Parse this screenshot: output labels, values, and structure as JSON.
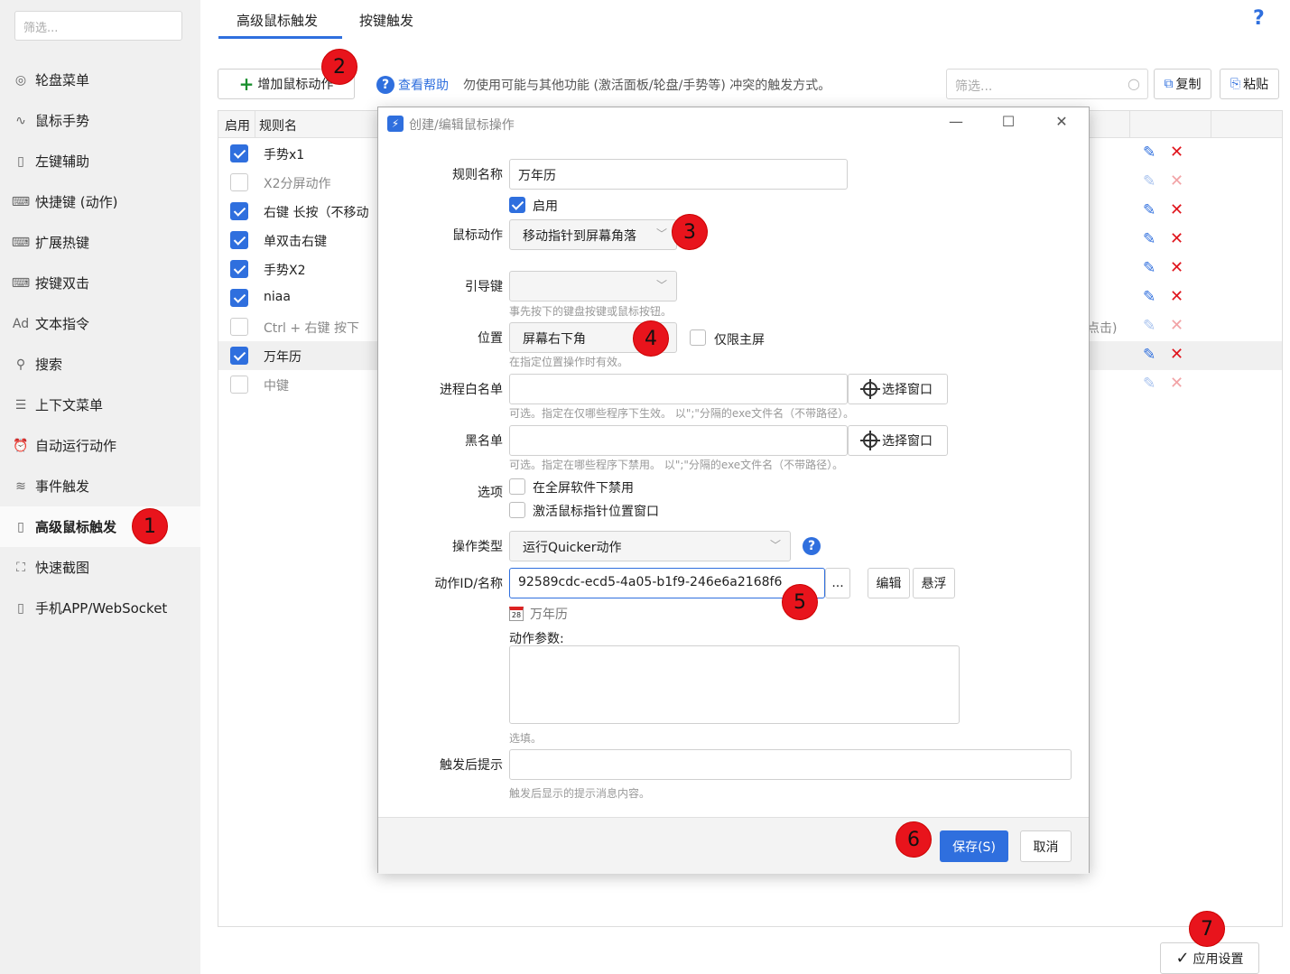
{
  "sidebar": {
    "filter_placeholder": "筛选...",
    "items": [
      {
        "label": "轮盘菜单",
        "icon": "◎"
      },
      {
        "label": "鼠标手势",
        "icon": "∿"
      },
      {
        "label": "左键辅助",
        "icon": "▯"
      },
      {
        "label": "快捷键 (动作)",
        "icon": "⌨"
      },
      {
        "label": "扩展热键",
        "icon": "⌨"
      },
      {
        "label": "按键双击",
        "icon": "⌨"
      },
      {
        "label": "文本指令",
        "icon": "Ad"
      },
      {
        "label": "搜索",
        "icon": "⚲"
      },
      {
        "label": "上下文菜单",
        "icon": "☰"
      },
      {
        "label": "自动运行动作",
        "icon": "⏰"
      },
      {
        "label": "事件触发",
        "icon": "≋"
      },
      {
        "label": "高级鼠标触发",
        "icon": "▯"
      },
      {
        "label": "快速截图",
        "icon": "⛶"
      },
      {
        "label": "手机APP/WebSocket",
        "icon": "▯"
      }
    ]
  },
  "tabs": [
    "高级鼠标触发",
    "按键触发"
  ],
  "help_icon": "?",
  "toolbar": {
    "add_label": "增加鼠标动作",
    "help_link": "查看帮助",
    "hint": "勿使用可能与其他功能 (激活面板/轮盘/手势等) 冲突的触发方式。",
    "filter_placeholder": "筛选...",
    "copy_label": "复制",
    "paste_label": "粘贴"
  },
  "table": {
    "headers": [
      "启用",
      "规则名"
    ],
    "rows": [
      {
        "enabled": true,
        "name": "手势x1",
        "extra": ""
      },
      {
        "enabled": false,
        "name": "X2分屏动作",
        "extra": ""
      },
      {
        "enabled": true,
        "name": "右键 长按（不移动",
        "extra": ""
      },
      {
        "enabled": true,
        "name": "单双击右键",
        "extra": ""
      },
      {
        "enabled": true,
        "name": "手势X2",
        "extra": ""
      },
      {
        "enabled": true,
        "name": "niaa",
        "extra": ""
      },
      {
        "enabled": false,
        "name": "Ctrl + 右键 按下",
        "extra": "点击)"
      },
      {
        "enabled": true,
        "name": "万年历",
        "extra": ""
      },
      {
        "enabled": false,
        "name": "中键",
        "extra": ""
      }
    ]
  },
  "apply_label": "应用设置",
  "badges": [
    "1",
    "2",
    "3",
    "4",
    "5",
    "6",
    "7"
  ],
  "dialog": {
    "title": "创建/编辑鼠标操作",
    "labels": {
      "rule_name": "规则名称",
      "mouse_action": "鼠标动作",
      "lead_key": "引导键",
      "position": "位置",
      "whitelist": "进程白名单",
      "blacklist": "黑名单",
      "options": "选项",
      "op_type": "操作类型",
      "action_id": "动作ID/名称",
      "action_params": "动作参数:",
      "after_tip": "触发后提示"
    },
    "rule_name_value": "万年历",
    "enabled_label": "启用",
    "mouse_action_value": "移动指针到屏幕角落",
    "lead_key_hint": "事先按下的键盘按键或鼠标按钮。",
    "position_value": "屏幕右下角",
    "primary_only_label": "仅限主屏",
    "position_hint": "在指定位置操作时有效。",
    "select_window_label": "选择窗口",
    "whitelist_hint": "可选。指定在仅哪些程序下生效。 以\";\"分隔的exe文件名（不带路径）。",
    "blacklist_hint": "可选。指定在哪些程序下禁用。 以\";\"分隔的exe文件名（不带路径）。",
    "opt1": "在全屏软件下禁用",
    "opt2": "激活鼠标指针位置窗口",
    "op_type_value": "运行Quicker动作",
    "action_id_value": "92589cdc-ecd5-4a05-b1f9-246e6a2168f6",
    "more_label": "...",
    "edit_label": "编辑",
    "float_label": "悬浮",
    "action_name": "万年历",
    "params_hint": "选填。",
    "after_tip_hint": "触发后显示的提示消息内容。",
    "save_label": "保存(S)",
    "cancel_label": "取消",
    "calendar_day": "28"
  }
}
